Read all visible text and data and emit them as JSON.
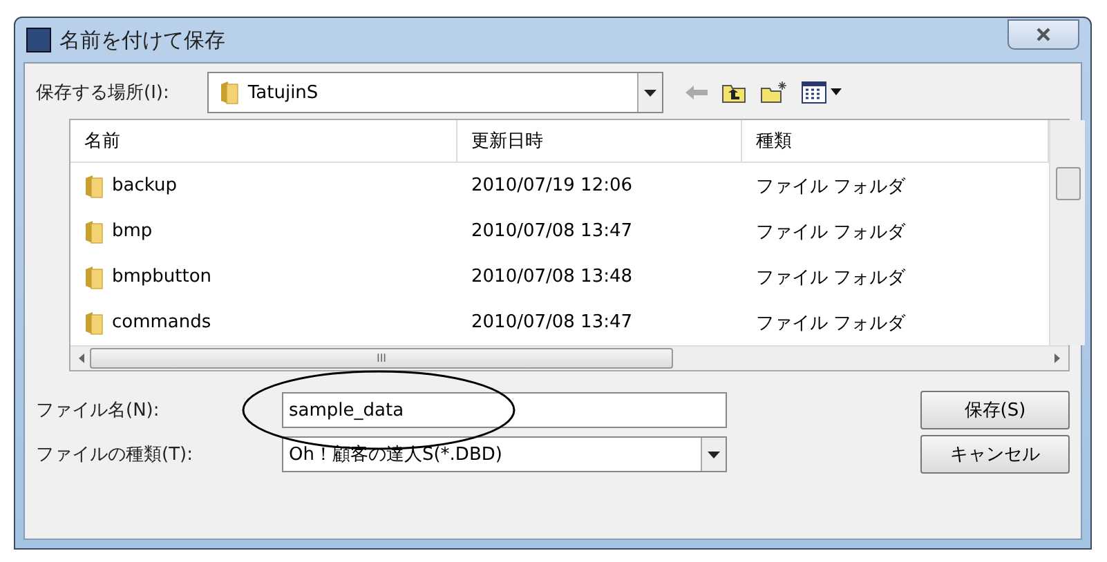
{
  "window": {
    "title": "名前を付けて保存"
  },
  "location": {
    "label": "保存する場所(I):",
    "value": "TatujinS"
  },
  "table": {
    "columns": [
      "名前",
      "更新日時",
      "種類"
    ],
    "rows": [
      {
        "name": "backup",
        "date": "2010/07/19 12:06",
        "type": "ファイル フォルダ"
      },
      {
        "name": "bmp",
        "date": "2010/07/08 13:47",
        "type": "ファイル フォルダ"
      },
      {
        "name": "bmpbutton",
        "date": "2010/07/08 13:48",
        "type": "ファイル フォルダ"
      },
      {
        "name": "commands",
        "date": "2010/07/08 13:47",
        "type": "ファイル フォルダ"
      }
    ]
  },
  "file_name": {
    "label": "ファイル名(N):",
    "value": "sample_data"
  },
  "file_type": {
    "label": "ファイルの種類(T):",
    "value": "Oh！顧客の達人S(*.DBD)"
  },
  "scrollbar_grip": "III",
  "buttons": [
    "保存(S)",
    "キャンセル"
  ]
}
